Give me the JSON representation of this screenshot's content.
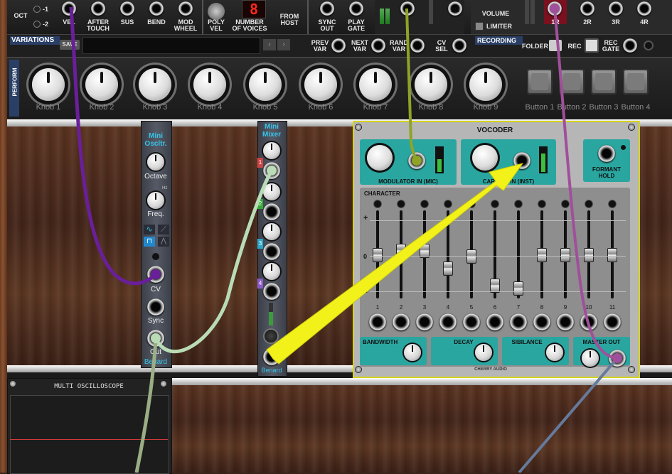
{
  "top_bar": {
    "oct_label": "OCT",
    "oct_minus1": "-1",
    "oct_minus2": "-2",
    "vel_label": "VEL",
    "aftertouch_label": "AFTER\nTOUCH",
    "sus_label": "SUS",
    "bend_label": "BEND",
    "modwheel_label": "MOD\nWHEEL",
    "polyvel_label": "POLY\nVEL",
    "numvoices_label": "NUMBER\nOF VOICES",
    "voices_display": "8",
    "fromhost_label": "FROM\nHOST",
    "syncout_label": "SYNC\nOUT",
    "playgate_label": "PLAY\nGATE",
    "out_2r_label": "2R",
    "volume_label": "VOLUME",
    "limiter_label": "LIMITER",
    "out_1r": "1R",
    "out_2r_b": "2R",
    "out_3r": "3R",
    "out_4r": "4R"
  },
  "variations": {
    "title": "VARIATIONS",
    "save_label": "SAVE",
    "prev_label": "PREV\nVAR",
    "next_label": "NEXT\nVAR",
    "rand_label": "RAND\nVAR",
    "cvsel_label": "CV\nSEL"
  },
  "recording": {
    "title": "RECORDING",
    "folder_label": "FOLDER",
    "rec_label": "REC",
    "recgate_label": "REC\nGATE"
  },
  "perform": {
    "title": "PERFORM",
    "knobs": [
      "Knob 1",
      "Knob 2",
      "Knob 3",
      "Knob 4",
      "Knob 5",
      "Knob 6",
      "Knob 7",
      "Knob 8",
      "Knob 9"
    ],
    "buttons": [
      "Button 1",
      "Button 2",
      "Button 3",
      "Button 4"
    ]
  },
  "mini_osc": {
    "title": "Mini\nOscltr.",
    "octave_label": "Octave",
    "hz_label": "Hz",
    "freq_label": "Freq.",
    "cv_label": "CV",
    "sync_label": "Sync",
    "out_label": "Out",
    "brand": "Benard"
  },
  "mini_mixer": {
    "title": "Mini\nMixer",
    "ch": [
      "1",
      "2",
      "3",
      "4"
    ],
    "brand": "Benard"
  },
  "vocoder": {
    "title": "VOCODER",
    "mod_in_label": "MODULATOR IN (MIC)",
    "car_in_label": "CARRIER IN (INST)",
    "formant_label": "FORMANT\nHOLD",
    "character_label": "CHARACTER",
    "plus": "+",
    "zero": "0",
    "minus": "–",
    "bands": [
      "1",
      "2",
      "3",
      "4",
      "5",
      "6",
      "7",
      "8",
      "9",
      "10",
      "11"
    ],
    "band_levels": [
      0.5,
      0.55,
      0.55,
      0.35,
      0.48,
      0.15,
      0.12,
      0.5,
      0.5,
      0.5,
      0.5
    ],
    "bandwidth_label": "BANDWIDTH",
    "decay_label": "DECAY",
    "sibilance_label": "SIBILANCE",
    "master_label": "MASTER OUT",
    "brand": "CHERRY AUDIO"
  },
  "scope": {
    "title": "MULTI OSCILLOSCOPE"
  },
  "colors": {
    "cable_purple": "#6a1f9a",
    "cable_olive": "#8fa326",
    "cable_pink": "#a0509a",
    "cable_mint": "#b9dcb6",
    "cable_blue": "#667a9c",
    "arrow_yellow": "#f2f21a",
    "vocoder_teal": "#2aa6a0"
  }
}
